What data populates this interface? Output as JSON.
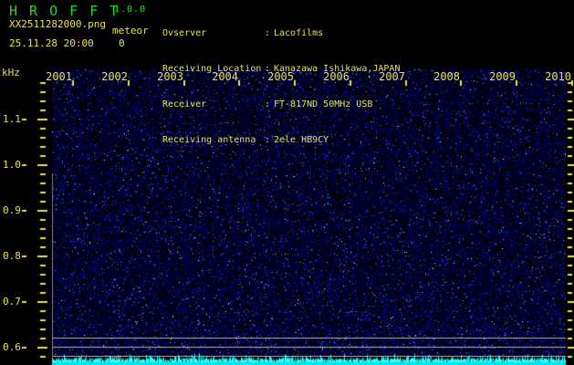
{
  "header": {
    "app_title": "H R O F F T",
    "version": "1.0.0",
    "filename": "XX2511282000.png",
    "mode": "meteor",
    "timestamp": "25.11.28 20:00",
    "count": "0",
    "info": {
      "separator": ":",
      "rows": [
        {
          "label": "Ovserver",
          "value": "Lacofilms"
        },
        {
          "label": "Receiving Location",
          "value": "Kanazawa Ishikawa,JAPAN"
        },
        {
          "label": "Receiver",
          "value": "FT-817ND 50MHz USB"
        },
        {
          "label": "Receiving antenna",
          "value": "2ele HB9CY"
        }
      ]
    }
  },
  "chart_data": {
    "type": "heatmap",
    "title": "HROFFT 10-minute radio meteor observation spectrogram",
    "ylabel": "kHz",
    "x_tick_labels": [
      "2001",
      "2002",
      "2003",
      "2004",
      "2005",
      "2006",
      "2007",
      "2008",
      "2009",
      "2010"
    ],
    "y_tick_labels": [
      "1.1",
      "1.0",
      "0.9",
      "0.8",
      "0.7",
      "0.6"
    ],
    "y_ticks_khz": [
      1.1,
      1.0,
      0.9,
      0.8,
      0.7,
      0.6
    ],
    "y_minor_step_khz": 0.02,
    "y_range_khz": [
      0.578,
      1.208
    ],
    "marker_lines_khz": [
      0.62,
      0.6,
      0.58
    ],
    "content": "uniform dark-blue background noise, no meteor echo streaks",
    "signal_level_strip": "flat cyan noise-floor meter with small spikes along bottom",
    "grid": false,
    "legend_position": "none"
  },
  "colors": {
    "background": "#000000",
    "title_green": "#22dd22",
    "text_yellow": "#e9e44a",
    "marker_line_gray": "#b4b4b4",
    "level_strip_cyan": "#00e8e8",
    "noise_blue": "#0000c8"
  }
}
